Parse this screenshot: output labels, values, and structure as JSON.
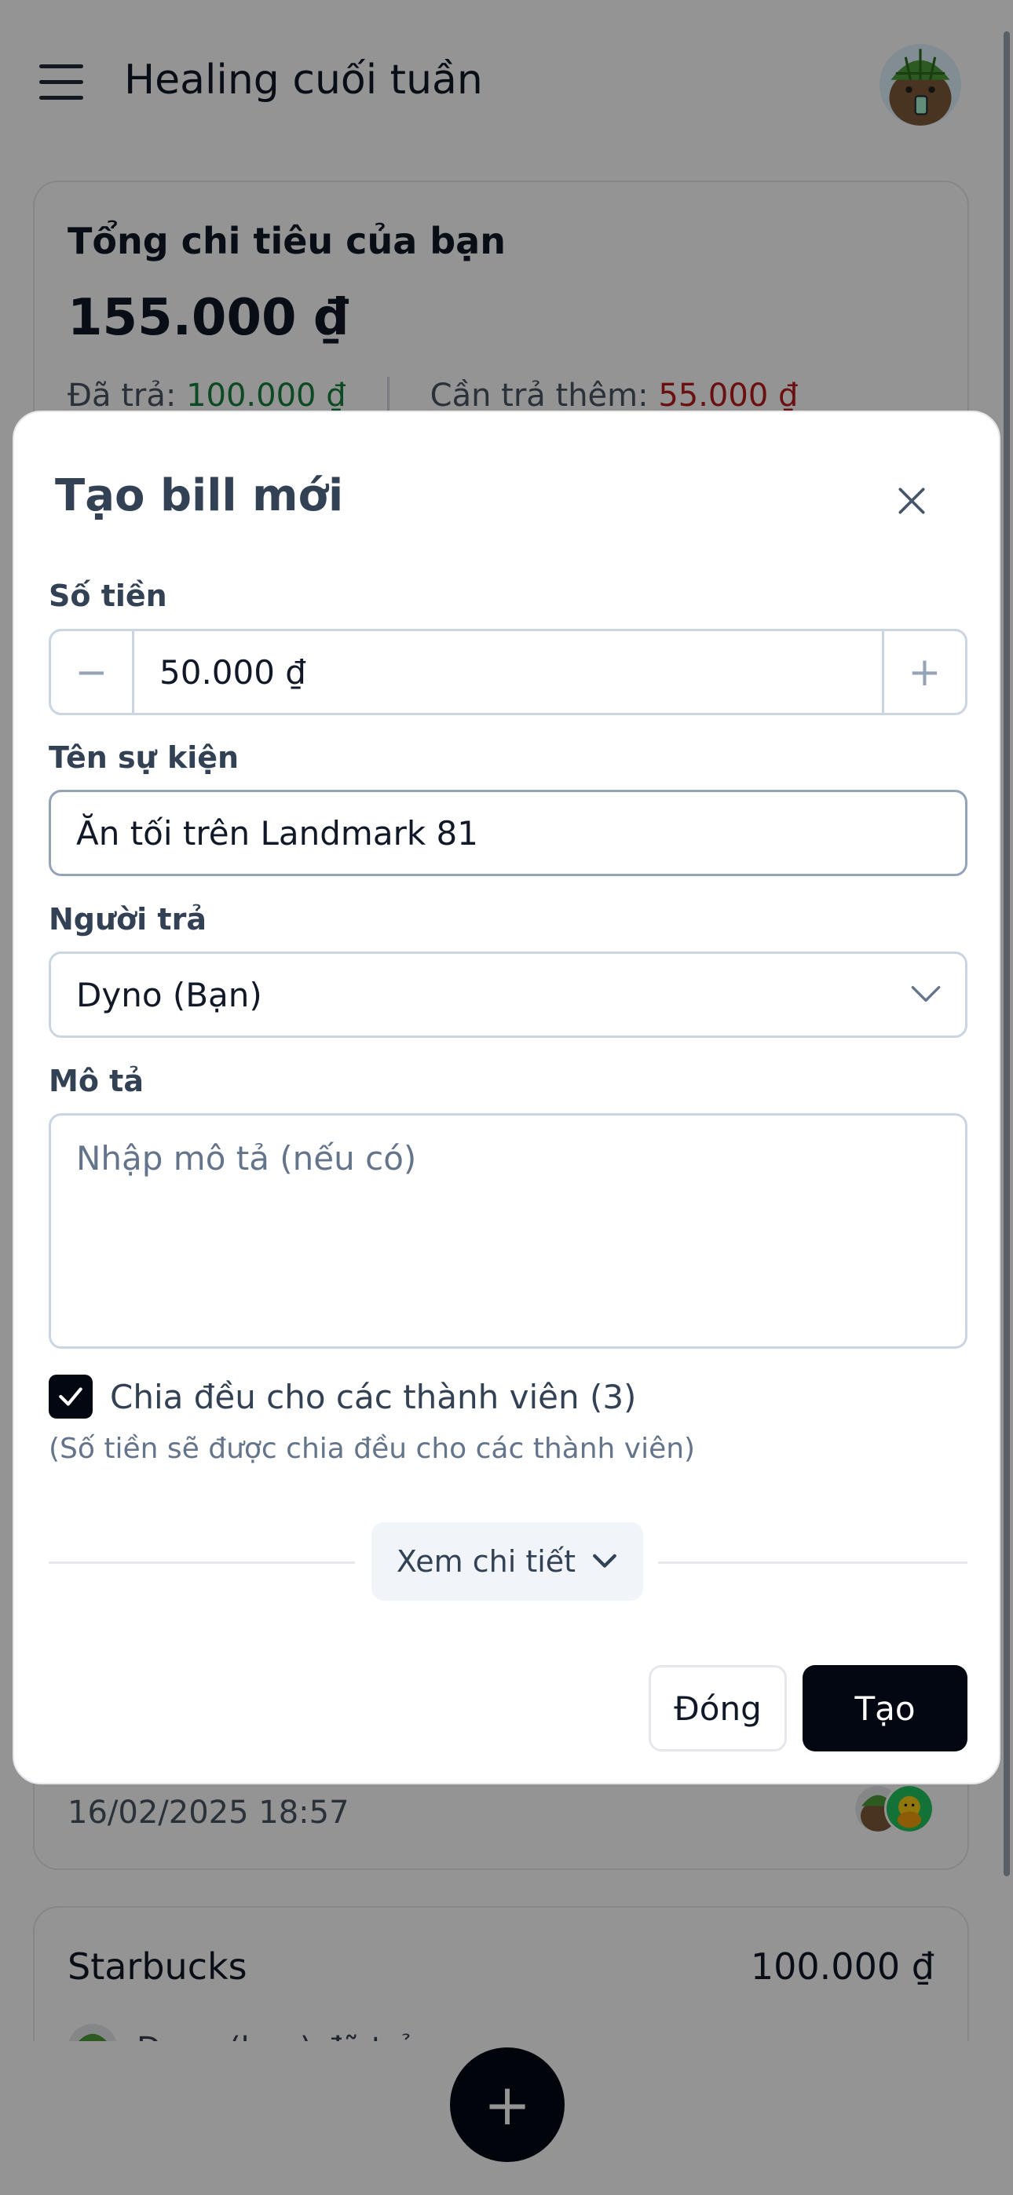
{
  "app": {
    "title": "Healing cuối tuần"
  },
  "summary": {
    "title": "Tổng chi tiêu của bạn",
    "total": "155.000 ₫",
    "paid_label": "Đã trả:",
    "paid_value": "100.000 ₫",
    "owe_label": "Cần trả thêm:",
    "owe_value": "55.000 ₫"
  },
  "bills": [
    {
      "date": "16/02/2025 18:57"
    },
    {
      "name": "Starbucks",
      "amount": "100.000 ₫",
      "payer_text": "Dyno (bạn) đã trả"
    }
  ],
  "modal": {
    "title": "Tạo bill mới",
    "amount_label": "Số tiền",
    "amount_value": "50.000 ₫",
    "minus_symbol": "−",
    "plus_symbol": "+",
    "event_label": "Tên sự kiện",
    "event_value": "Ăn tối trên Landmark 81",
    "payer_label": "Người trả",
    "payer_value": "Dyno (Bạn)",
    "desc_label": "Mô tả",
    "desc_placeholder": "Nhập mô tả (nếu có)",
    "split_checked": true,
    "split_label": "Chia đều cho các thành viên (3)",
    "split_hint": "(Số tiền sẽ được chia đều cho các thành viên)",
    "details_label": "Xem chi tiết",
    "close_button": "Đóng",
    "create_button": "Tạo"
  },
  "fab": {
    "symbol": "+"
  },
  "colors": {
    "primary": "#030712",
    "paid": "#15803d",
    "owe": "#b91c1c",
    "overlay": "rgba(0,0,0,0.42)"
  },
  "icons": {
    "menu": "hamburger-icon",
    "close": "close-icon",
    "chevron": "chevron-down-icon",
    "check": "check-icon",
    "fab": "plus-icon"
  }
}
